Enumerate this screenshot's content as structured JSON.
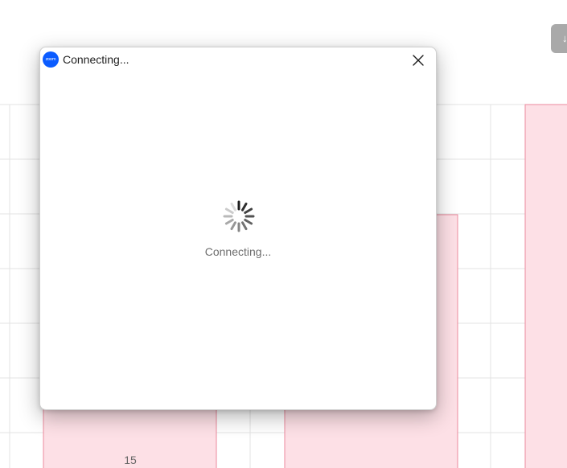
{
  "background": {
    "chart_data": {
      "type": "bar",
      "data_labels": [
        "15"
      ]
    },
    "download_icon": "download-icon"
  },
  "dialog": {
    "title": "Connecting...",
    "app_icon": {
      "name": "zoom-logo-icon",
      "text": "zoom",
      "color": "#0b5cff"
    },
    "close_icon": "close-icon",
    "spinner_icon": "loading-spinner-icon",
    "status_text": "Connecting..."
  }
}
